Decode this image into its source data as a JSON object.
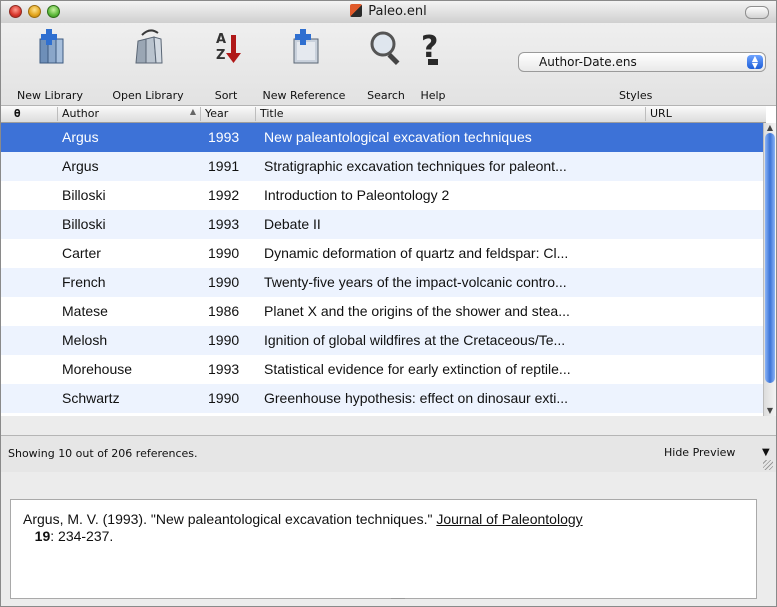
{
  "window": {
    "title": "Paleo.enl"
  },
  "toolbar": {
    "new_library": "New Library",
    "open_library": "Open Library",
    "sort": "Sort",
    "new_reference": "New Reference",
    "search": "Search",
    "help": "Help",
    "styles_label": "Styles",
    "styles_value": "Author-Date.ens"
  },
  "table": {
    "headers": {
      "attach": "",
      "author": "Author",
      "year": "Year",
      "title": "Title",
      "url": "URL"
    },
    "sort_indicator": "▲",
    "rows": [
      {
        "author": "Argus",
        "year": "1993",
        "title": "New paleantological excavation techniques",
        "selected": true
      },
      {
        "author": "Argus",
        "year": "1991",
        "title": "Stratigraphic excavation techniques for paleont..."
      },
      {
        "author": "Billoski",
        "year": "1992",
        "title": "Introduction to Paleontology 2"
      },
      {
        "author": "Billoski",
        "year": "1993",
        "title": "Debate II"
      },
      {
        "author": "Carter",
        "year": "1990",
        "title": "Dynamic deformation of quartz and feldspar: Cl..."
      },
      {
        "author": "French",
        "year": "1990",
        "title": "Twenty-five years of the impact-volcanic contro..."
      },
      {
        "author": "Matese",
        "year": "1986",
        "title": "Planet X and the origins of the shower and stea..."
      },
      {
        "author": "Melosh",
        "year": "1990",
        "title": "Ignition of global wildfires at the Cretaceous/Te..."
      },
      {
        "author": "Morehouse",
        "year": "1993",
        "title": "Statistical evidence for early extinction of reptile..."
      },
      {
        "author": "Schwartz",
        "year": "1990",
        "title": "Greenhouse hypothesis: effect on dinosaur exti..."
      }
    ]
  },
  "status": {
    "text": "Showing 10 out of 206 references.",
    "hide_preview": "Hide Preview"
  },
  "preview": {
    "prefix": "Argus, M. V. (1993). \"New paleantological excavation techniques.\" ",
    "journal": "Journal of Paleontology",
    "volume": "19",
    "pages": ": 234-237."
  },
  "colors": {
    "selection": "#3d72d7",
    "stripe": "#edf3fe"
  }
}
